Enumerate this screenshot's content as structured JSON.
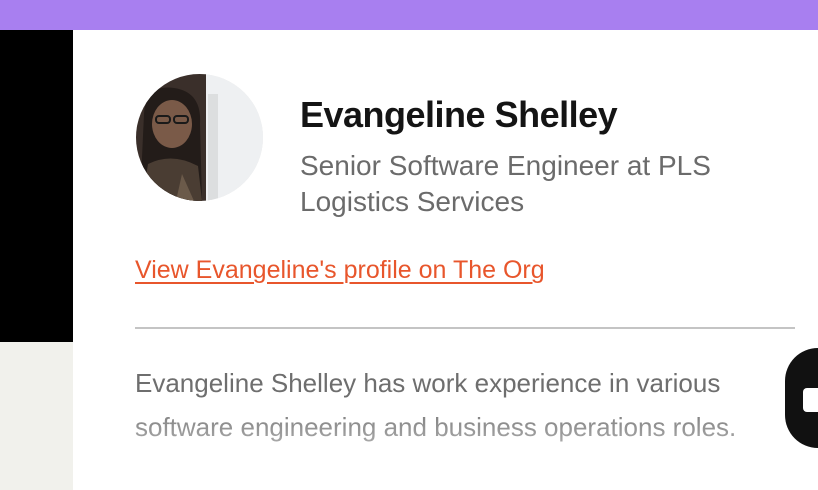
{
  "profile": {
    "name": "Evangeline Shelley",
    "title": "Senior Software Engineer at PLS Logistics Services",
    "link_text": "View Evangeline's profile on The Org",
    "bio": "Evangeline Shelley has work experience in various software engineering and business operations roles."
  },
  "colors": {
    "top_bar": "#a87ff0",
    "link": "#e8562c",
    "name": "#141414",
    "secondary_text": "#6b6b6b"
  },
  "icons": {
    "chat": "chat-icon",
    "avatar": "profile-photo"
  }
}
